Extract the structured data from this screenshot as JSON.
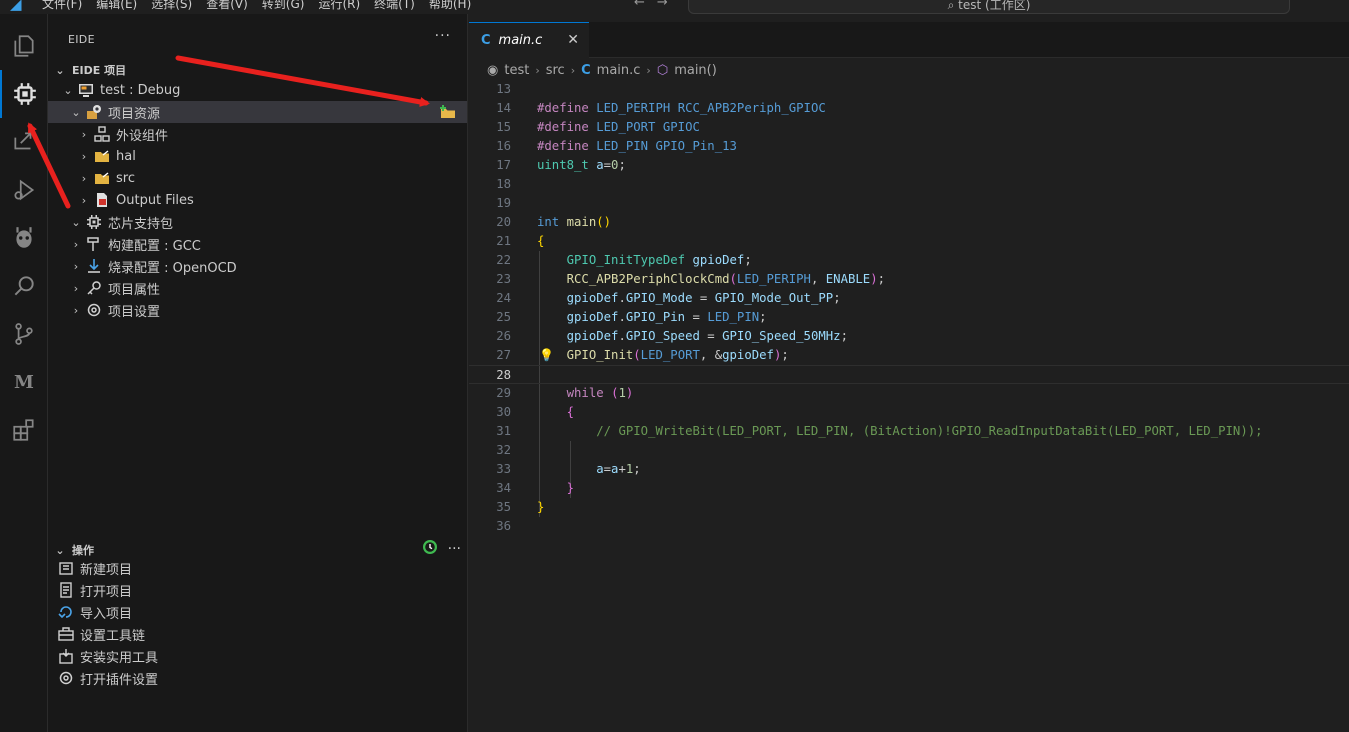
{
  "menu": [
    "文件(F)",
    "编辑(E)",
    "选择(S)",
    "查看(V)",
    "转到(G)",
    "运行(R)",
    "终端(T)",
    "帮助(H)"
  ],
  "search": {
    "text": "test (工作区)"
  },
  "sidebar": {
    "title": "EIDE",
    "more": "···",
    "section_project": "EIDE 项目",
    "tree": [
      {
        "label": "test : Debug"
      },
      {
        "label": "项目资源"
      },
      {
        "label": "外设组件"
      },
      {
        "label": "hal"
      },
      {
        "label": "src"
      },
      {
        "label": "Output Files"
      },
      {
        "label": "芯片支持包"
      },
      {
        "label": "构建配置 : GCC"
      },
      {
        "label": "烧录配置 : OpenOCD"
      },
      {
        "label": "项目属性"
      },
      {
        "label": "项目设置"
      }
    ],
    "section_ops": "操作",
    "ops": [
      {
        "label": "新建项目"
      },
      {
        "label": "打开项目"
      },
      {
        "label": "导入项目"
      },
      {
        "label": "设置工具链"
      },
      {
        "label": "安装实用工具"
      },
      {
        "label": "打开插件设置"
      }
    ]
  },
  "editor": {
    "tab": {
      "name": "main.c",
      "close": "✕"
    },
    "breadcrumb": {
      "folder1": "test",
      "folder2": "src",
      "file": "main.c",
      "symbol": "main()"
    },
    "line_numbers": [
      "13",
      "14",
      "15",
      "16",
      "17",
      "18",
      "19",
      "20",
      "21",
      "22",
      "23",
      "24",
      "25",
      "26",
      "27",
      "28",
      "29",
      "30",
      "31",
      "32",
      "33",
      "34",
      "35",
      "36"
    ],
    "comment": "// GPIO_WriteBit(LED_PORT, LED_PIN, (BitAction)!GPIO_ReadInputDataBit(LED_PORT, LED_PIN));"
  },
  "colors": {
    "accent": "#0078d4",
    "annotation_arrow": "#e8211e"
  }
}
